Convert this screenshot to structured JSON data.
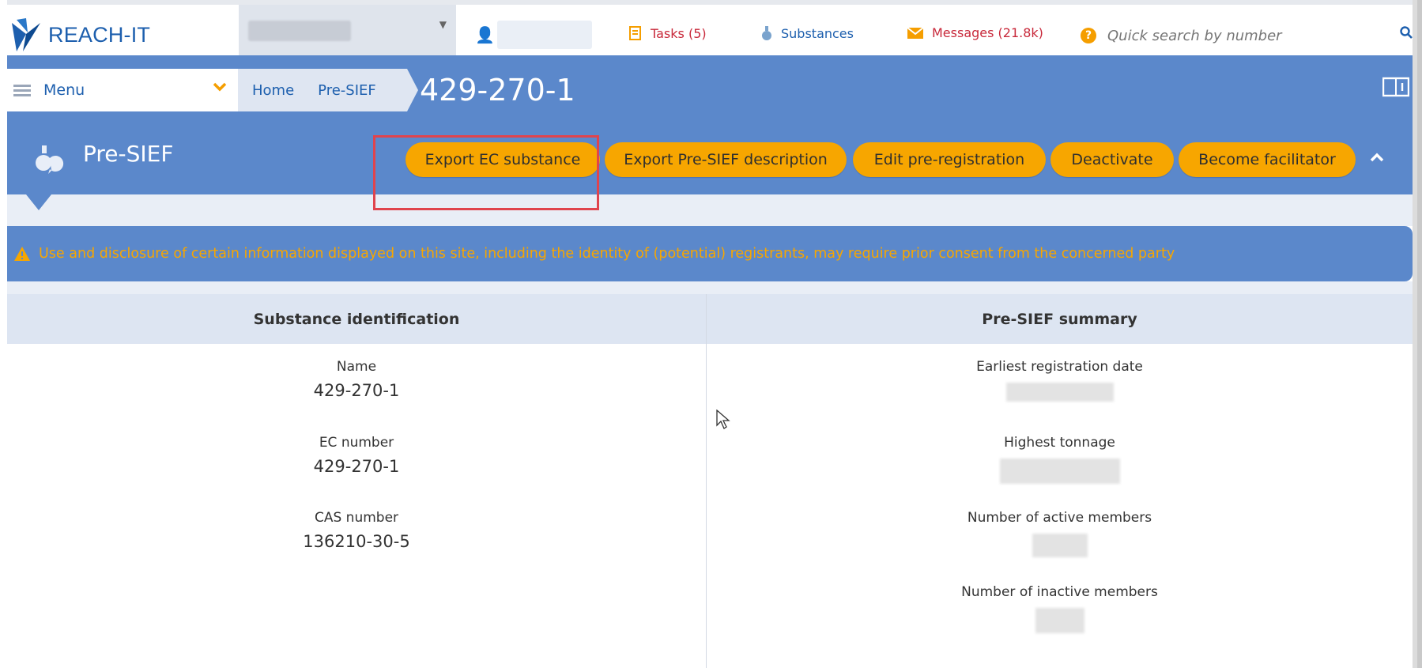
{
  "header": {
    "logo_text": "REACH-IT",
    "tasks_label": "Tasks (5)",
    "substances_label": "Substances",
    "messages_label": "Messages (21.8k)",
    "quick_search_placeholder": "Quick search by number",
    "icons": {
      "user": "user-icon",
      "tasks": "tasks-icon",
      "substances": "flask-icon",
      "messages": "envelope-icon",
      "help": "help-icon",
      "search": "search-icon"
    }
  },
  "navigation": {
    "menu_label": "Menu",
    "breadcrumbs": [
      "Home",
      "Pre-SIEF"
    ],
    "current_title": "429-270-1"
  },
  "section": {
    "title": "Pre-SIEF",
    "buttons": [
      "Export EC substance",
      "Export Pre-SIEF description",
      "Edit pre-registration",
      "Deactivate",
      "Become facilitator"
    ]
  },
  "warning": {
    "text": "Use and disclosure of certain information displayed on this site, including the identity of (potential) registrants, may require prior consent from the concerned party"
  },
  "substance_identification": {
    "heading": "Substance identification",
    "fields": [
      {
        "label": "Name",
        "value": "429-270-1"
      },
      {
        "label": "EC number",
        "value": "429-270-1"
      },
      {
        "label": "CAS number",
        "value": "136210-30-5"
      }
    ]
  },
  "pre_sief_summary": {
    "heading": "Pre-SIEF summary",
    "fields": [
      {
        "label": "Earliest registration date"
      },
      {
        "label": "Highest tonnage"
      },
      {
        "label": "Number of active members"
      },
      {
        "label": "Number of inactive members"
      }
    ]
  },
  "colors": {
    "brand_blue": "#5b88cb",
    "accent_orange": "#f7a600",
    "link_blue": "#1d5fae",
    "alert_red": "#c8283a"
  }
}
